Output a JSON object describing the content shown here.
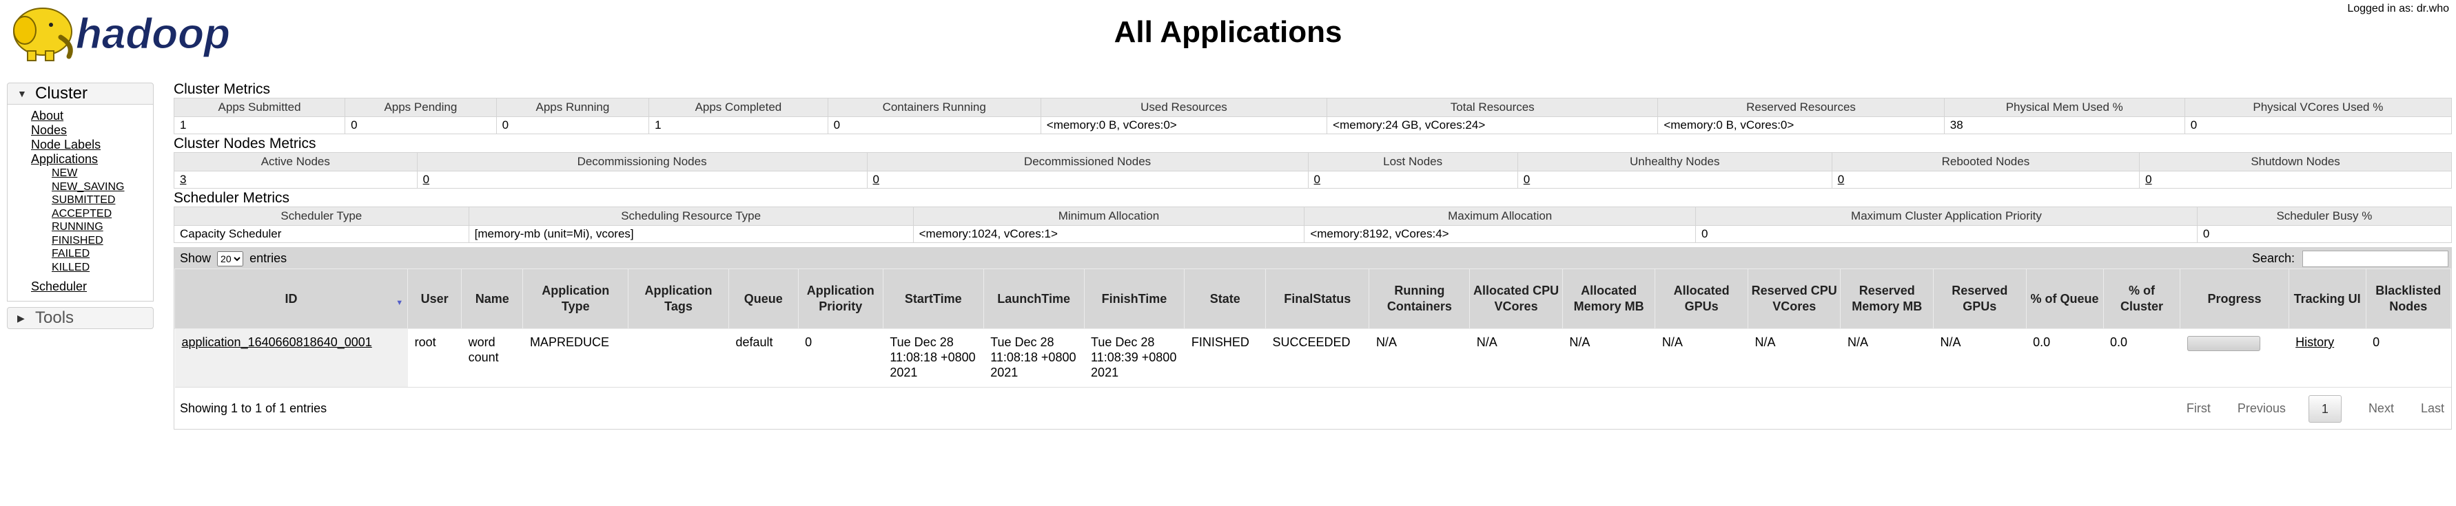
{
  "header": {
    "logo_text": "hadoop",
    "title": "All Applications",
    "logged_in": "Logged in as: dr.who"
  },
  "nav": {
    "cluster_label": "Cluster",
    "links": [
      "About",
      "Nodes",
      "Node Labels",
      "Applications"
    ],
    "states": [
      "NEW",
      "NEW_SAVING",
      "SUBMITTED",
      "ACCEPTED",
      "RUNNING",
      "FINISHED",
      "FAILED",
      "KILLED"
    ],
    "scheduler": "Scheduler",
    "tools_label": "Tools"
  },
  "cluster_metrics": {
    "title": "Cluster Metrics",
    "headers": [
      "Apps Submitted",
      "Apps Pending",
      "Apps Running",
      "Apps Completed",
      "Containers Running",
      "Used Resources",
      "Total Resources",
      "Reserved Resources",
      "Physical Mem Used %",
      "Physical VCores Used %"
    ],
    "values": [
      "1",
      "0",
      "0",
      "1",
      "0",
      "<memory:0 B, vCores:0>",
      "<memory:24 GB, vCores:24>",
      "<memory:0 B, vCores:0>",
      "38",
      "0"
    ]
  },
  "node_metrics": {
    "title": "Cluster Nodes Metrics",
    "headers": [
      "Active Nodes",
      "Decommissioning Nodes",
      "Decommissioned Nodes",
      "Lost Nodes",
      "Unhealthy Nodes",
      "Rebooted Nodes",
      "Shutdown Nodes"
    ],
    "values": [
      "3",
      "0",
      "0",
      "0",
      "0",
      "0",
      "0"
    ]
  },
  "scheduler_metrics": {
    "title": "Scheduler Metrics",
    "headers": [
      "Scheduler Type",
      "Scheduling Resource Type",
      "Minimum Allocation",
      "Maximum Allocation",
      "Maximum Cluster Application Priority",
      "Scheduler Busy %"
    ],
    "values": [
      "Capacity Scheduler",
      "[memory-mb (unit=Mi), vcores]",
      "<memory:1024, vCores:1>",
      "<memory:8192, vCores:4>",
      "0",
      "0"
    ]
  },
  "apps_table": {
    "show_label": "Show",
    "page_size": "20",
    "entries_label": "entries",
    "search_label": "Search:",
    "search_value": "",
    "headers": [
      "ID",
      "User",
      "Name",
      "Application Type",
      "Application Tags",
      "Queue",
      "Application Priority",
      "StartTime",
      "LaunchTime",
      "FinishTime",
      "State",
      "FinalStatus",
      "Running Containers",
      "Allocated CPU VCores",
      "Allocated Memory MB",
      "Allocated GPUs",
      "Reserved CPU VCores",
      "Reserved Memory MB",
      "Reserved GPUs",
      "% of Queue",
      "% of Cluster",
      "Progress",
      "Tracking UI",
      "Blacklisted Nodes"
    ],
    "rows": [
      {
        "id": "application_1640660818640_0001",
        "user": "root",
        "name": "word count",
        "type": "MAPREDUCE",
        "tags": "",
        "queue": "default",
        "priority": "0",
        "start": "Tue Dec 28 11:08:18 +0800 2021",
        "launch": "Tue Dec 28 11:08:18 +0800 2021",
        "finish": "Tue Dec 28 11:08:39 +0800 2021",
        "state": "FINISHED",
        "final_status": "SUCCEEDED",
        "running_containers": "N/A",
        "alloc_cpu": "N/A",
        "alloc_mem": "N/A",
        "alloc_gpu": "N/A",
        "res_cpu": "N/A",
        "res_mem": "N/A",
        "res_gpu": "N/A",
        "pct_queue": "0.0",
        "pct_cluster": "0.0",
        "progress": 1.0,
        "tracking": "History",
        "blacklisted": "0"
      }
    ],
    "info": "Showing 1 to 1 of 1 entries",
    "pager": {
      "first": "First",
      "previous": "Previous",
      "current": "1",
      "next": "Next",
      "last": "Last"
    }
  },
  "colors": {
    "header_bg": "#d6d6d6",
    "metrics_header_bg": "#eaeaea",
    "logo_yellow": "#f5d31b"
  }
}
